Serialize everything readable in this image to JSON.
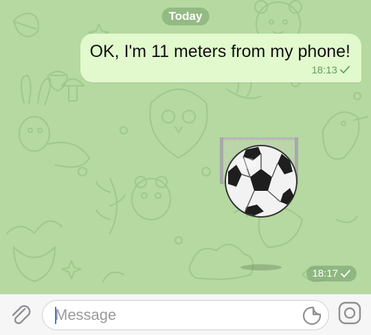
{
  "chat": {
    "date_label": "Today",
    "messages": [
      {
        "text": "OK, I'm 11 meters from my phone!",
        "time": "18:13",
        "status": "sent"
      }
    ],
    "sticker": {
      "icon": "soccer-ball-goal-sticker",
      "time": "18:17",
      "status": "sent"
    }
  },
  "composer": {
    "placeholder": "Message",
    "value": "",
    "icons": {
      "attach": "paperclip-icon",
      "sticker": "sticker-icon",
      "camera": "camera-icon"
    }
  },
  "colors": {
    "wallpaper": "#b5d9a0",
    "bubble": "#e1f9cd",
    "time_in_bubble": "#5fa05a",
    "cursor": "#3478f6"
  }
}
